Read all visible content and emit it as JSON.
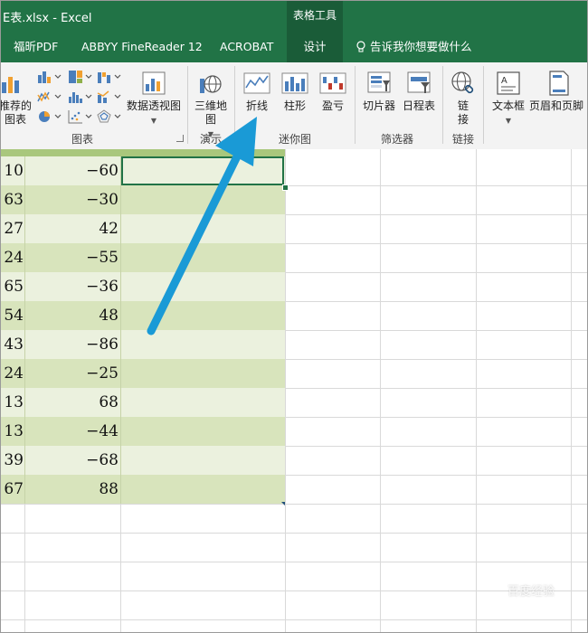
{
  "window": {
    "title": "E表.xlsx  -  Excel",
    "context_title": "表格工具"
  },
  "tabs": [
    {
      "label": "福昕PDF"
    },
    {
      "label": "ABBYY FineReader 12"
    },
    {
      "label": "ACROBAT"
    },
    {
      "label": "设计"
    }
  ],
  "tell_me": "告诉我你想要做什么",
  "ribbon": {
    "recommended": "推荐的\n图表",
    "pivot_chart": "数据透视图",
    "map_3d": "三维地\n图",
    "line": "折线",
    "column": "柱形",
    "winloss": "盈亏",
    "slicer": "切片器",
    "timeline": "日程表",
    "link": "链\n接",
    "textbox": "文本框",
    "header_footer": "页眉和页脚",
    "groups": {
      "charts": "图表",
      "tours": "演示",
      "sparklines": "迷你图",
      "filters": "筛选器",
      "links": "链接"
    }
  },
  "table": {
    "rows": [
      {
        "a": "10",
        "b": "−60"
      },
      {
        "a": "63",
        "b": "−30"
      },
      {
        "a": "27",
        "b": "42"
      },
      {
        "a": "24",
        "b": "−55"
      },
      {
        "a": "65",
        "b": "−36"
      },
      {
        "a": "54",
        "b": "48"
      },
      {
        "a": "43",
        "b": "−86"
      },
      {
        "a": "24",
        "b": "−25"
      },
      {
        "a": "13",
        "b": "68"
      },
      {
        "a": "13",
        "b": "−44"
      },
      {
        "a": "39",
        "b": "−68"
      },
      {
        "a": "67",
        "b": "88"
      }
    ]
  },
  "colors": {
    "excel_green": "#217346",
    "row_band_dark": "#d8e4bc",
    "row_band_light": "#ebf1de",
    "arrow": "#1a9ad6"
  },
  "watermark": "百度经验"
}
